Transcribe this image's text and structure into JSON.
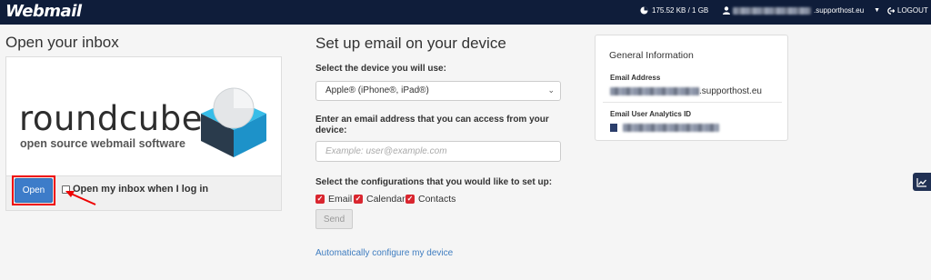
{
  "header": {
    "logo": "Webmail",
    "disk_usage": "175.52 KB / 1 GB",
    "user_domain": ".supporthost.eu",
    "logout_label": "LOGOUT"
  },
  "left": {
    "title": "Open your inbox",
    "brand_name": "roundcube",
    "brand_tagline": "open source webmail software",
    "open_button": "Open",
    "checkbox_label": "Open my inbox when I log in",
    "checkbox_checked": false
  },
  "setup": {
    "title": "Set up email on your device",
    "device_label": "Select the device you will use:",
    "device_selected": "Apple® (iPhone®, iPad®)",
    "email_label": "Enter an email address that you can access from your device:",
    "email_placeholder": "Example: user@example.com",
    "config_label": "Select the configurations that you would like to set up:",
    "configs": [
      {
        "label": "Email",
        "checked": true
      },
      {
        "label": "Calendar",
        "checked": true
      },
      {
        "label": "Contacts",
        "checked": true
      }
    ],
    "send_button": "Send",
    "auto_link": "Automatically configure my device"
  },
  "info": {
    "title": "General Information",
    "email_address_label": "Email Address",
    "email_address_domain": ".supporthost.eu",
    "analytics_label": "Email User Analytics ID"
  },
  "colors": {
    "topbar": "#0f1d3a",
    "primary_button": "#3d7cc9",
    "checkbox_checked": "#d9262f",
    "highlight_outline": "#ee0000",
    "link": "#3f7dc0"
  },
  "icons": {
    "disk": "pie-chart-icon",
    "user": "user-icon",
    "logout": "logout-icon",
    "copy": "copy-icon",
    "side_widget": "chart-trend-icon"
  }
}
